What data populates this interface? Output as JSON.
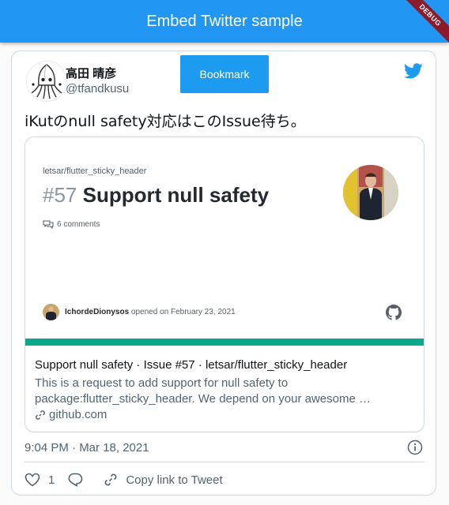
{
  "appbar": {
    "title": "Embed Twitter sample",
    "debug_label": "DEBUG"
  },
  "tweet": {
    "author": {
      "name": "高田 晴彦",
      "handle": "@tfandkusu"
    },
    "bookmark_label": "Bookmark",
    "text": "iKutのnull safety対応はこのIssue待ち。",
    "link_card": {
      "preview": {
        "repo": "letsar/flutter_sticky_header",
        "issue_number": "#57",
        "issue_title": "Support null safety",
        "comments": "6 comments",
        "user": "IchordeDionysos",
        "opened_text": "opened on February 23, 2021",
        "accent_color": "#0aa98c"
      },
      "title": "Support null safety · Issue #57 · letsar/flutter_sticky_header",
      "description": "This is a request to add support for null safety to package:flutter_sticky_header. We depend on your awesome …",
      "domain": "github.com"
    },
    "timestamp": "9:04 PM · Mar 18, 2021",
    "actions": {
      "like_count": "1",
      "copy_link_label": "Copy link to Tweet"
    }
  },
  "colors": {
    "appbar": "#2196f3",
    "twitter_blue": "#1d9bf0",
    "text_secondary": "#536471"
  },
  "icons": [
    "twitter-bird-icon",
    "comments-icon",
    "github-icon",
    "link-icon",
    "info-icon",
    "heart-icon",
    "reply-icon",
    "copy-link-icon"
  ]
}
